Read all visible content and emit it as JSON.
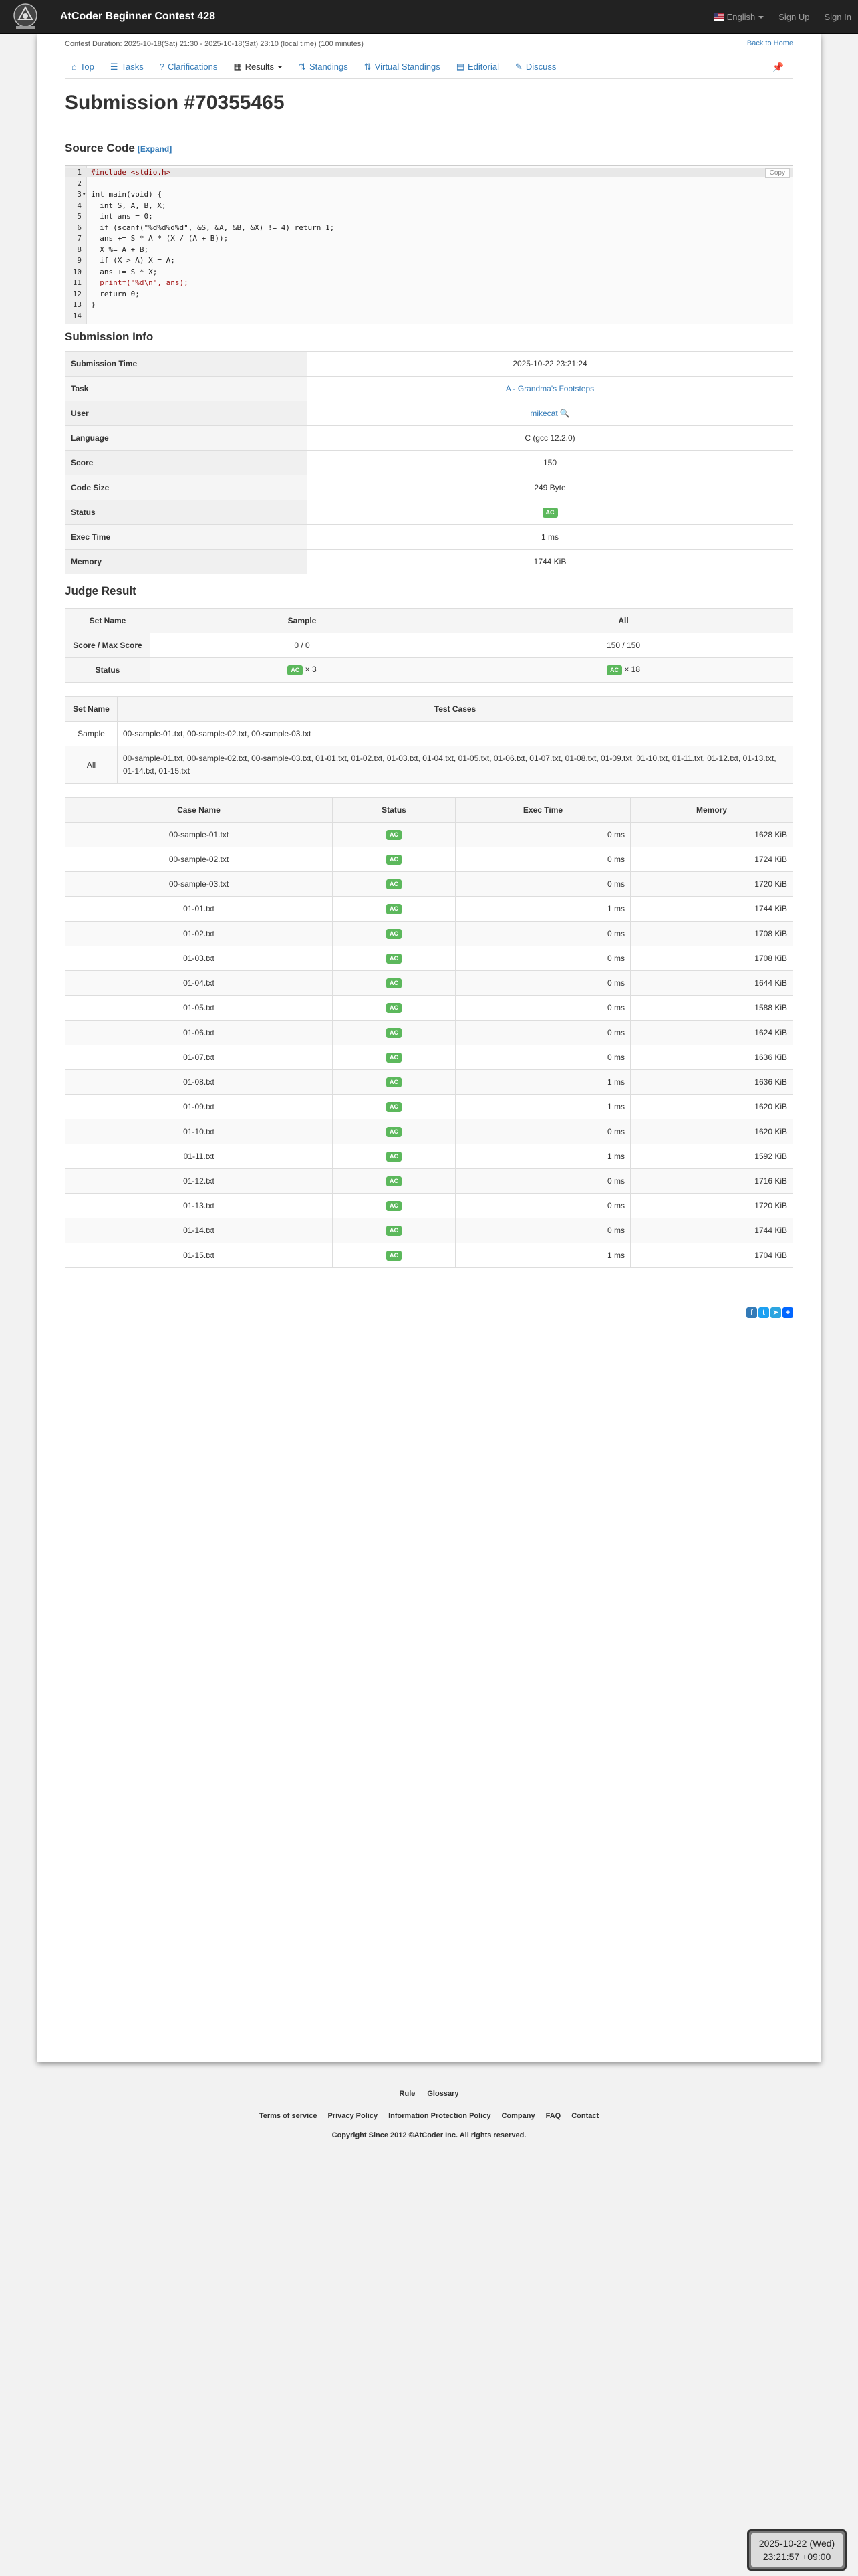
{
  "navbar": {
    "contest_title": "AtCoder Beginner Contest 428",
    "language": "English",
    "sign_up": "Sign Up",
    "sign_in": "Sign In"
  },
  "header": {
    "duration": "Contest Duration: 2025-10-18(Sat) 21:30 - 2025-10-18(Sat) 23:10 (local time) (100 minutes)",
    "back_home": "Back to Home"
  },
  "tabs": [
    {
      "label": "Top",
      "icon": "home-icon"
    },
    {
      "label": "Tasks",
      "icon": "list-icon"
    },
    {
      "label": "Clarifications",
      "icon": "question-icon"
    },
    {
      "label": "Results",
      "icon": "table-icon"
    },
    {
      "label": "Standings",
      "icon": "sort-icon"
    },
    {
      "label": "Virtual Standings",
      "icon": "sort-icon"
    },
    {
      "label": "Editorial",
      "icon": "book-icon"
    },
    {
      "label": "Discuss",
      "icon": "comment-icon"
    }
  ],
  "page_title": "Submission #70355465",
  "source_code": {
    "heading": "Source Code",
    "expand": "[Expand]",
    "copy": "Copy",
    "lines": [
      "#include <stdio.h>",
      "",
      "int main(void) {",
      "  int S, A, B, X;",
      "  int ans = 0;",
      "  if (scanf(\"%d%d%d%d\", &S, &A, &B, &X) != 4) return 1;",
      "  ans += S * A * (X / (A + B));",
      "  X %= A + B;",
      "  if (X > A) X = A;",
      "  ans += S * X;",
      "  printf(\"%d\\n\", ans);",
      "  return 0;",
      "}",
      ""
    ]
  },
  "submission_info": {
    "heading": "Submission Info",
    "rows": [
      {
        "label": "Submission Time",
        "value": "2025-10-22 23:21:24"
      },
      {
        "label": "Task",
        "value": "A - Grandma's Footsteps"
      },
      {
        "label": "User",
        "value": "mikecat"
      },
      {
        "label": "Language",
        "value": "C (gcc 12.2.0)"
      },
      {
        "label": "Score",
        "value": "150"
      },
      {
        "label": "Code Size",
        "value": "249 Byte"
      },
      {
        "label": "Status",
        "value": "AC"
      },
      {
        "label": "Exec Time",
        "value": "1 ms"
      },
      {
        "label": "Memory",
        "value": "1744 KiB"
      }
    ]
  },
  "judge_result": {
    "heading": "Judge Result",
    "headers": [
      "Set Name",
      "Sample",
      "All"
    ],
    "score_label": "Score / Max Score",
    "score_sample": "0 / 0",
    "score_all": "150 / 150",
    "status_label": "Status",
    "status_badge": "AC",
    "status_sample_count": "× 3",
    "status_all_count": "× 18"
  },
  "test_sets": {
    "headers": [
      "Set Name",
      "Test Cases"
    ],
    "rows": [
      {
        "name": "Sample",
        "cases": "00-sample-01.txt, 00-sample-02.txt, 00-sample-03.txt"
      },
      {
        "name": "All",
        "cases": "00-sample-01.txt, 00-sample-02.txt, 00-sample-03.txt, 01-01.txt, 01-02.txt, 01-03.txt, 01-04.txt, 01-05.txt, 01-06.txt, 01-07.txt, 01-08.txt, 01-09.txt, 01-10.txt, 01-11.txt, 01-12.txt, 01-13.txt, 01-14.txt, 01-15.txt"
      }
    ]
  },
  "cases": {
    "headers": [
      "Case Name",
      "Status",
      "Exec Time",
      "Memory"
    ],
    "rows": [
      {
        "name": "00-sample-01.txt",
        "status": "AC",
        "time": "0 ms",
        "memory": "1628 KiB"
      },
      {
        "name": "00-sample-02.txt",
        "status": "AC",
        "time": "0 ms",
        "memory": "1724 KiB"
      },
      {
        "name": "00-sample-03.txt",
        "status": "AC",
        "time": "0 ms",
        "memory": "1720 KiB"
      },
      {
        "name": "01-01.txt",
        "status": "AC",
        "time": "1 ms",
        "memory": "1744 KiB"
      },
      {
        "name": "01-02.txt",
        "status": "AC",
        "time": "0 ms",
        "memory": "1708 KiB"
      },
      {
        "name": "01-03.txt",
        "status": "AC",
        "time": "0 ms",
        "memory": "1708 KiB"
      },
      {
        "name": "01-04.txt",
        "status": "AC",
        "time": "0 ms",
        "memory": "1644 KiB"
      },
      {
        "name": "01-05.txt",
        "status": "AC",
        "time": "0 ms",
        "memory": "1588 KiB"
      },
      {
        "name": "01-06.txt",
        "status": "AC",
        "time": "0 ms",
        "memory": "1624 KiB"
      },
      {
        "name": "01-07.txt",
        "status": "AC",
        "time": "0 ms",
        "memory": "1636 KiB"
      },
      {
        "name": "01-08.txt",
        "status": "AC",
        "time": "1 ms",
        "memory": "1636 KiB"
      },
      {
        "name": "01-09.txt",
        "status": "AC",
        "time": "1 ms",
        "memory": "1620 KiB"
      },
      {
        "name": "01-10.txt",
        "status": "AC",
        "time": "0 ms",
        "memory": "1620 KiB"
      },
      {
        "name": "01-11.txt",
        "status": "AC",
        "time": "1 ms",
        "memory": "1592 KiB"
      },
      {
        "name": "01-12.txt",
        "status": "AC",
        "time": "0 ms",
        "memory": "1716 KiB"
      },
      {
        "name": "01-13.txt",
        "status": "AC",
        "time": "0 ms",
        "memory": "1720 KiB"
      },
      {
        "name": "01-14.txt",
        "status": "AC",
        "time": "0 ms",
        "memory": "1744 KiB"
      },
      {
        "name": "01-15.txt",
        "status": "AC",
        "time": "1 ms",
        "memory": "1704 KiB"
      }
    ]
  },
  "footer": {
    "links1": [
      "Rule",
      "Glossary"
    ],
    "links2": [
      "Terms of service",
      "Privacy Policy",
      "Information Protection Policy",
      "Company",
      "FAQ",
      "Contact"
    ],
    "copyright": "Copyright Since 2012 ©AtCoder Inc. All rights reserved."
  },
  "clock": {
    "date": "2025-10-22 (Wed)",
    "time": "23:21:57 +09:00"
  },
  "colors": {
    "accent": "#337ab7",
    "ac": "#5cb85c",
    "navbar": "#222222"
  }
}
